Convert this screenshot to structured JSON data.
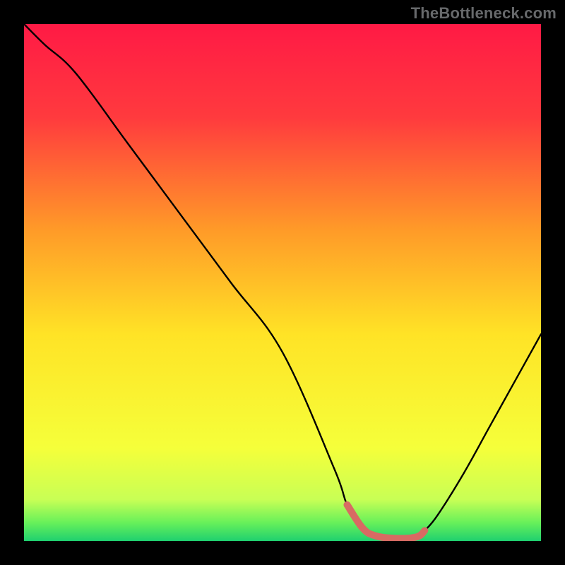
{
  "watermark": "TheBottleneck.com",
  "chart_data": {
    "type": "line",
    "title": "",
    "xlabel": "",
    "ylabel": "",
    "xlim": [
      0,
      100
    ],
    "ylim": [
      0,
      100
    ],
    "grid": false,
    "series": [
      {
        "name": "curve",
        "x": [
          0,
          4,
          10,
          20,
          30,
          40,
          50,
          60,
          62.5,
          65.5,
          68,
          72,
          76,
          77.5,
          80,
          85,
          90,
          95,
          100
        ],
        "values": [
          100,
          96,
          90.5,
          77,
          63.5,
          50,
          36.5,
          14,
          7,
          2.5,
          1,
          0.5,
          0.8,
          2,
          5,
          13,
          22,
          31,
          40
        ]
      }
    ],
    "highlight_segment": {
      "name": "min-band",
      "x": [
        62.5,
        65.5,
        68,
        72,
        76,
        77.5
      ],
      "values": [
        7,
        2.5,
        1,
        0.5,
        0.8,
        2
      ]
    },
    "background_gradient": {
      "stops": [
        {
          "pos": 0.0,
          "color": "#ff1a45"
        },
        {
          "pos": 0.18,
          "color": "#ff3a3e"
        },
        {
          "pos": 0.4,
          "color": "#ff9b28"
        },
        {
          "pos": 0.6,
          "color": "#ffe326"
        },
        {
          "pos": 0.82,
          "color": "#f5ff3a"
        },
        {
          "pos": 0.92,
          "color": "#c8ff55"
        },
        {
          "pos": 0.965,
          "color": "#66f05a"
        },
        {
          "pos": 1.0,
          "color": "#1fd06f"
        }
      ]
    },
    "colors": {
      "curve": "#000000",
      "highlight": "#d86a63",
      "frame": "#000000"
    }
  }
}
